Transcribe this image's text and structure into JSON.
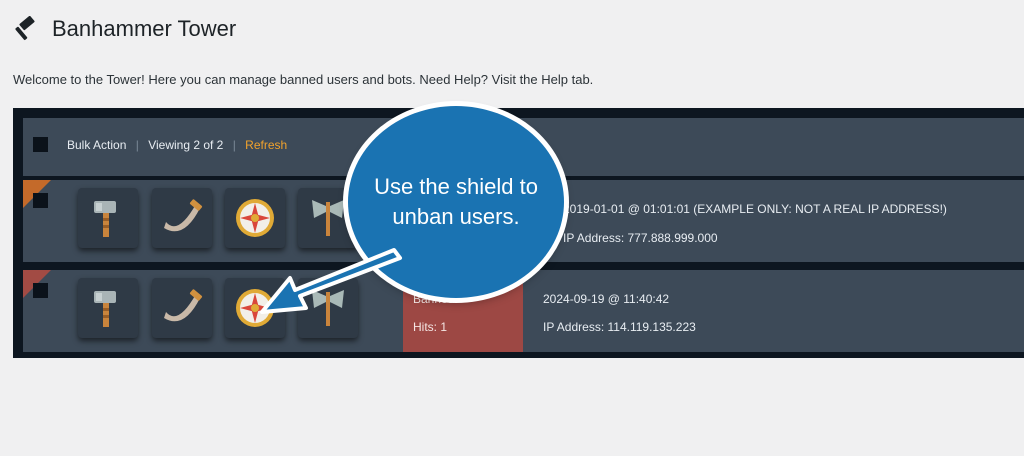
{
  "page": {
    "title": "Banhammer Tower",
    "intro": "Welcome to the Tower! Here you can manage banned users and bots. Need Help? Visit the Help tab."
  },
  "toolbar": {
    "bulk_action": "Bulk Action",
    "viewing": "Viewing 2 of 2",
    "refresh": "Refresh"
  },
  "rows": [
    {
      "date": "2019-01-01 @ 01:01:01 (EXAMPLE ONLY: NOT A REAL IP ADDRESS!)",
      "ip": "IP Address: 777.888.999.000",
      "corner_color": "#c46a2a"
    },
    {
      "status": "Banned",
      "hits": "Hits: 1",
      "date": "2024-09-19 @ 11:40:42",
      "ip": "IP Address: 114.119.135.223",
      "corner_color": "#a24b44"
    }
  ],
  "row_icons": [
    "hammer-icon",
    "horn-icon",
    "shield-icon",
    "axe-icon"
  ],
  "callout": {
    "text": "Use the shield to unban users.",
    "color": "#1a73b2"
  }
}
